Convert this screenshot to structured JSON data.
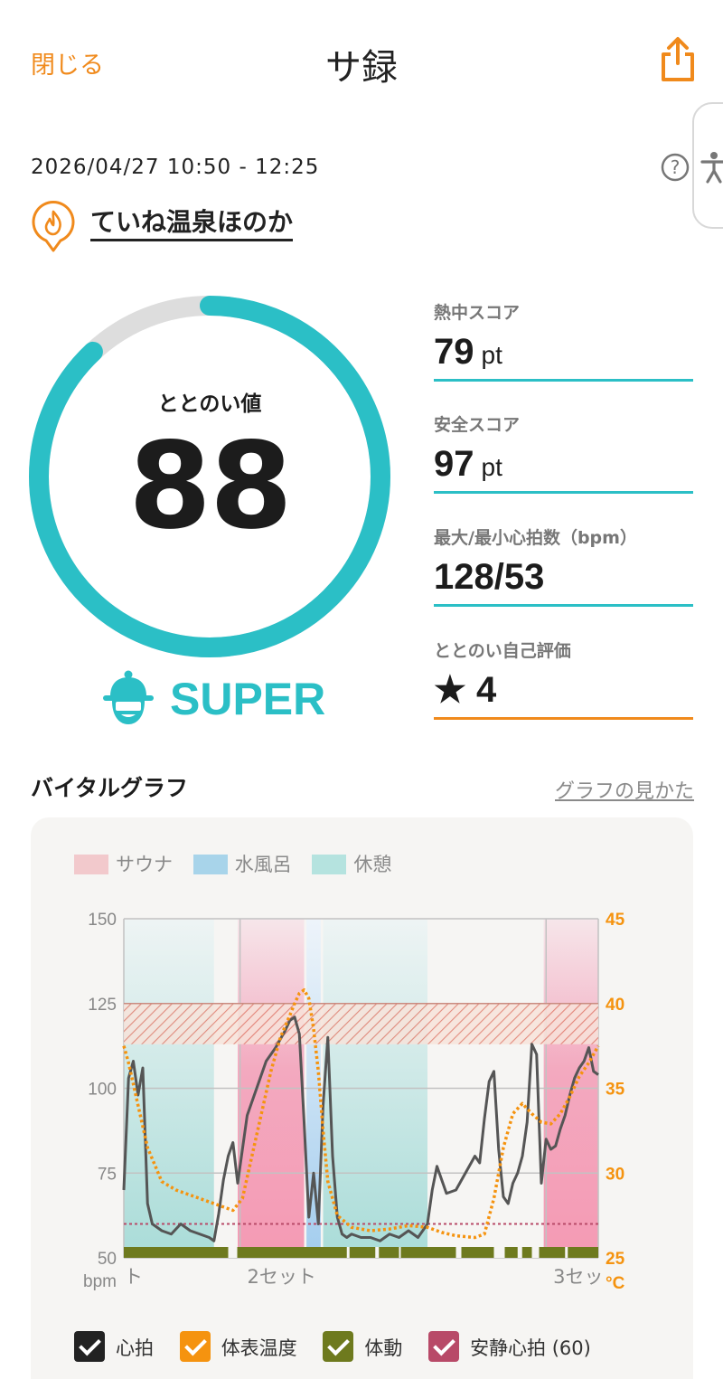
{
  "header": {
    "close_label": "閉じる",
    "title": "サ録"
  },
  "session": {
    "datetime": "2026/04/27 10:50 - 12:25",
    "venue": "ていね温泉ほのか"
  },
  "score": {
    "label": "ととのい値",
    "value": "88",
    "progress": 0.88,
    "rank": "SUPER",
    "accent_color": "#2bbfc6",
    "track_color": "#dddddd"
  },
  "metrics": [
    {
      "label": "熱中スコア",
      "value": "79",
      "unit": "pt"
    },
    {
      "label": "安全スコア",
      "value": "97",
      "unit": "pt"
    },
    {
      "label": "最大/最小心拍数（bpm）",
      "value": "128/53",
      "unit": ""
    },
    {
      "label": "ととのい自己評価",
      "value": "★ 4",
      "unit": ""
    }
  ],
  "graph": {
    "section_title": "バイタルグラフ",
    "how_to_link": "グラフの見かた",
    "phase_legend": [
      {
        "label": "サウナ",
        "color": "#f2c9cc"
      },
      {
        "label": "水風呂",
        "color": "#a8d4ea"
      },
      {
        "label": "休憩",
        "color": "#b5e3df"
      }
    ],
    "series_legend": [
      {
        "label": "心拍",
        "color": "#222222"
      },
      {
        "label": "体表温度",
        "color": "#f5930f"
      },
      {
        "label": "体動",
        "color": "#6e7a1e"
      },
      {
        "label": "安静心拍 (60)",
        "color": "#b84a68"
      }
    ]
  },
  "chart_data": {
    "type": "line",
    "x_tick_labels": [
      "ト",
      "2セット",
      "3セッ"
    ],
    "left_axis": {
      "unit": "bpm",
      "ticks": [
        50,
        75,
        100,
        125,
        150
      ],
      "range": [
        50,
        150
      ]
    },
    "right_axis": {
      "unit": "°C",
      "ticks": [
        25,
        30,
        35,
        40,
        45
      ],
      "range": [
        25,
        45
      ],
      "color": "#f5930f"
    },
    "danger_band_bpm": [
      113,
      125
    ],
    "resting_hr_line": 60,
    "phases": [
      {
        "type": "休憩",
        "start": 0,
        "end": 0.19
      },
      {
        "type": "サウナ",
        "start": 0.24,
        "end": 0.38
      },
      {
        "type": "水風呂",
        "start": 0.385,
        "end": 0.415
      },
      {
        "type": "休憩",
        "start": 0.42,
        "end": 0.64
      },
      {
        "type": "サウナ",
        "start": 0.885,
        "end": 1.0
      }
    ],
    "series": [
      {
        "name": "心拍",
        "x": [
          0,
          0.01,
          0.02,
          0.03,
          0.04,
          0.05,
          0.06,
          0.07,
          0.08,
          0.1,
          0.12,
          0.14,
          0.16,
          0.18,
          0.19,
          0.2,
          0.21,
          0.22,
          0.23,
          0.24,
          0.26,
          0.28,
          0.3,
          0.32,
          0.34,
          0.35,
          0.36,
          0.37,
          0.38,
          0.39,
          0.4,
          0.41,
          0.42,
          0.43,
          0.44,
          0.45,
          0.46,
          0.47,
          0.48,
          0.5,
          0.52,
          0.54,
          0.56,
          0.58,
          0.6,
          0.62,
          0.64,
          0.65,
          0.66,
          0.67,
          0.68,
          0.7,
          0.72,
          0.74,
          0.75,
          0.76,
          0.77,
          0.78,
          0.79,
          0.8,
          0.81,
          0.82,
          0.83,
          0.84,
          0.85,
          0.86,
          0.87,
          0.88,
          0.89,
          0.9,
          0.91,
          0.92,
          0.93,
          0.94,
          0.95,
          0.96,
          0.97,
          0.98,
          0.99,
          1.0
        ],
        "values": [
          70,
          103,
          108,
          98,
          106,
          66,
          60,
          59,
          58,
          57,
          60,
          58,
          57,
          56,
          55,
          63,
          73,
          80,
          84,
          72,
          92,
          100,
          108,
          112,
          117,
          120,
          121,
          116,
          90,
          62,
          75,
          60,
          95,
          115,
          80,
          62,
          57,
          56,
          57,
          56,
          56,
          55,
          57,
          56,
          58,
          56,
          60,
          70,
          77,
          73,
          69,
          70,
          75,
          80,
          78,
          91,
          102,
          105,
          82,
          68,
          66,
          72,
          75,
          80,
          90,
          113,
          110,
          72,
          85,
          82,
          83,
          88,
          92,
          98,
          103,
          106,
          108,
          112,
          105,
          104
        ]
      },
      {
        "name": "体表温度",
        "x": [
          0,
          0.01,
          0.03,
          0.05,
          0.08,
          0.11,
          0.14,
          0.17,
          0.2,
          0.23,
          0.25,
          0.27,
          0.29,
          0.31,
          0.33,
          0.35,
          0.36,
          0.37,
          0.38,
          0.39,
          0.4,
          0.41,
          0.42,
          0.43,
          0.45,
          0.48,
          0.52,
          0.56,
          0.6,
          0.64,
          0.67,
          0.7,
          0.74,
          0.76,
          0.78,
          0.8,
          0.82,
          0.84,
          0.86,
          0.88,
          0.9,
          0.92,
          0.94,
          0.96,
          0.98,
          1.0
        ],
        "values": [
          37.5,
          36.5,
          34.0,
          31.5,
          29.5,
          29.0,
          28.7,
          28.4,
          28.1,
          27.8,
          28.5,
          31.0,
          33.5,
          36.0,
          38.0,
          39.3,
          40.0,
          40.6,
          40.8,
          40.3,
          38.5,
          36.0,
          32.5,
          29.5,
          27.5,
          26.8,
          26.6,
          26.7,
          26.9,
          26.8,
          26.5,
          26.3,
          26.2,
          26.4,
          28.5,
          31.5,
          33.5,
          34.1,
          33.5,
          33.0,
          32.9,
          33.5,
          34.5,
          35.7,
          36.5,
          37.5
        ]
      }
    ]
  }
}
